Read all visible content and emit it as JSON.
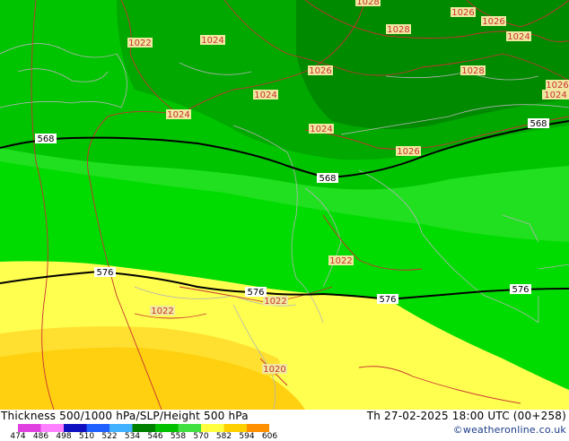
{
  "footer": {
    "title": "Thickness 500/1000 hPa/SLP/Height 500 hPa",
    "valid_time": "Th 27-02-2025 18:00 UTC (00+258)",
    "credit": "©weatheronline.co.uk"
  },
  "legend": {
    "ticks": [
      "474",
      "486",
      "498",
      "510",
      "522",
      "534",
      "546",
      "558",
      "570",
      "582",
      "594",
      "606"
    ],
    "colors": [
      "#e040e0",
      "#ff80ff",
      "#1010c0",
      "#2060ff",
      "#40b0ff",
      "#008000",
      "#00c000",
      "#40e040",
      "#ffff40",
      "#ffd000",
      "#ff9000"
    ]
  },
  "isohypses": [
    {
      "label": "568"
    },
    {
      "label": "576"
    }
  ],
  "isobar_labels": [
    "1028",
    "1026",
    "1026",
    "1024",
    "1028",
    "1022",
    "1024",
    "1026",
    "1028",
    "1026",
    "1024",
    "1024",
    "1024",
    "1026",
    "1024",
    "1026",
    "1022",
    "1022",
    "1022",
    "1020"
  ],
  "height_labels": [
    "568",
    "568",
    "568",
    "576",
    "576",
    "576",
    "576"
  ],
  "colors": {
    "band_534": "#00a800",
    "band_546": "#00c400",
    "band_558": "#20e020",
    "band_570": "#ffff50",
    "band_582": "#ffd010",
    "isobar": "#c83232",
    "isohypse": "#000000",
    "coast": "#b4b4b4"
  }
}
